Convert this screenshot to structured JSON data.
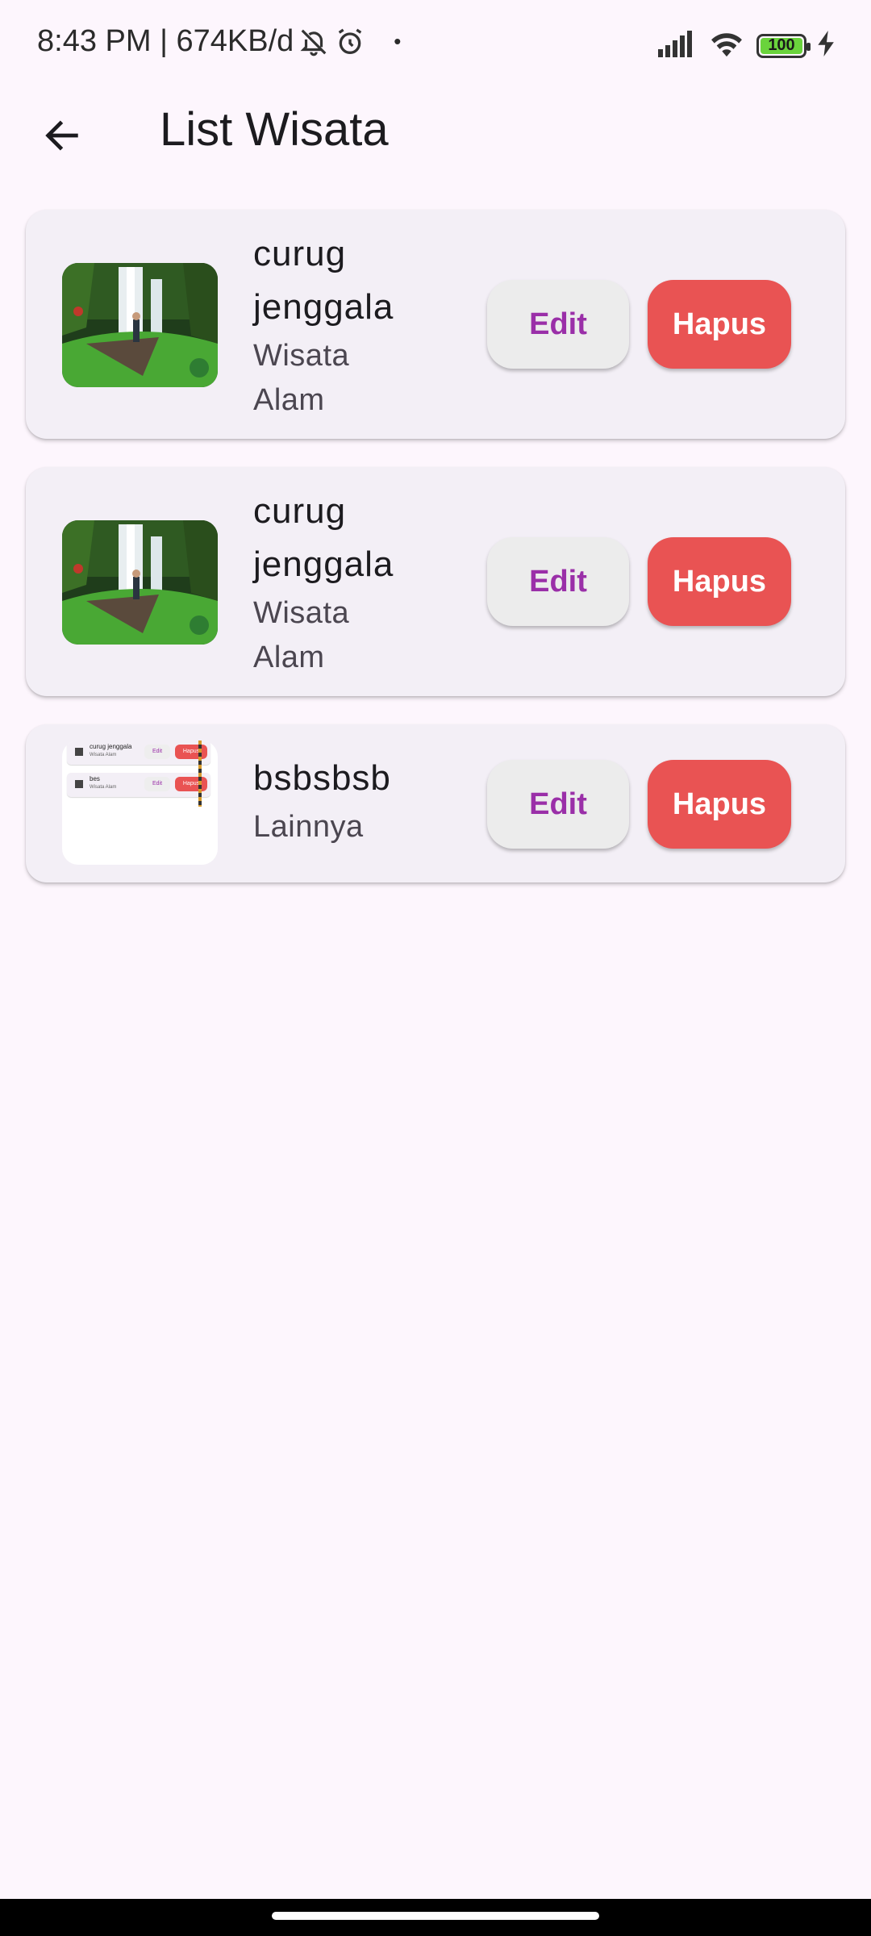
{
  "status_bar": {
    "time_info": "8:43 PM | 674KB/d",
    "dot": "•",
    "battery": "100",
    "icons": [
      "bell-off-icon",
      "alarm-icon",
      "signal-icon",
      "wifi-icon",
      "battery-icon",
      "charging-icon"
    ]
  },
  "app_bar": {
    "title": "List Wisata",
    "back_icon": "arrow-left-icon"
  },
  "items": [
    {
      "name_line1": "curug",
      "name_line2": "jenggala",
      "category_line1": "Wisata",
      "category_line2": "Alam",
      "image": "waterfall-photo",
      "edit_label": "Edit",
      "delete_label": "Hapus"
    },
    {
      "name_line1": "curug",
      "name_line2": "jenggala",
      "category_line1": "Wisata",
      "category_line2": "Alam",
      "image": "waterfall-photo",
      "edit_label": "Edit",
      "delete_label": "Hapus"
    },
    {
      "name": "bsbsbsb",
      "category": "Lainnya",
      "image": "app-screenshot",
      "edit_label": "Edit",
      "delete_label": "Hapus",
      "thumb_rows": [
        {
          "name": "curug jenggala",
          "category": "Wisata Alam",
          "edit": "Edit",
          "delete": "Hapus"
        },
        {
          "name": "bes",
          "category": "Wisata Alam",
          "edit": "Edit",
          "delete": "Hapus"
        }
      ]
    }
  ],
  "colors": {
    "background": "#fdf6fd",
    "card": "#f3eff6",
    "edit_text": "#9a2fa8",
    "delete_bg": "#e95353"
  }
}
